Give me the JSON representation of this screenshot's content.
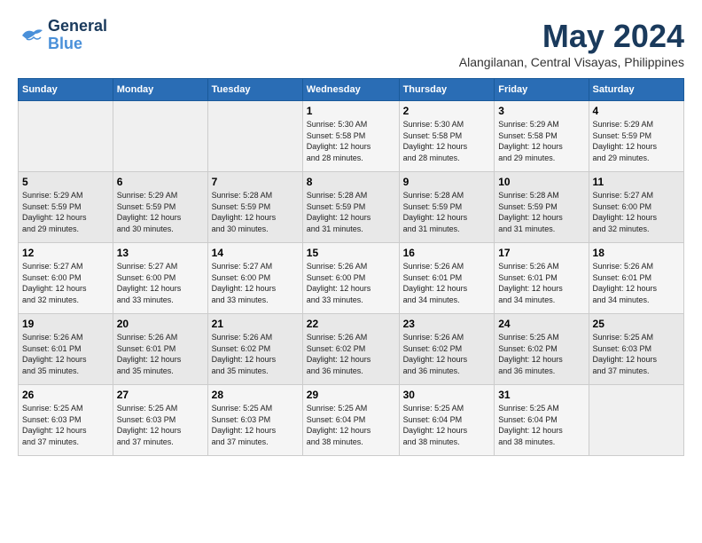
{
  "logo": {
    "line1": "General",
    "line2": "Blue"
  },
  "title": "May 2024",
  "subtitle": "Alangilanan, Central Visayas, Philippines",
  "days_of_week": [
    "Sunday",
    "Monday",
    "Tuesday",
    "Wednesday",
    "Thursday",
    "Friday",
    "Saturday"
  ],
  "weeks": [
    [
      {
        "day": "",
        "info": ""
      },
      {
        "day": "",
        "info": ""
      },
      {
        "day": "",
        "info": ""
      },
      {
        "day": "1",
        "info": "Sunrise: 5:30 AM\nSunset: 5:58 PM\nDaylight: 12 hours\nand 28 minutes."
      },
      {
        "day": "2",
        "info": "Sunrise: 5:30 AM\nSunset: 5:58 PM\nDaylight: 12 hours\nand 28 minutes."
      },
      {
        "day": "3",
        "info": "Sunrise: 5:29 AM\nSunset: 5:58 PM\nDaylight: 12 hours\nand 29 minutes."
      },
      {
        "day": "4",
        "info": "Sunrise: 5:29 AM\nSunset: 5:59 PM\nDaylight: 12 hours\nand 29 minutes."
      }
    ],
    [
      {
        "day": "5",
        "info": "Sunrise: 5:29 AM\nSunset: 5:59 PM\nDaylight: 12 hours\nand 29 minutes."
      },
      {
        "day": "6",
        "info": "Sunrise: 5:29 AM\nSunset: 5:59 PM\nDaylight: 12 hours\nand 30 minutes."
      },
      {
        "day": "7",
        "info": "Sunrise: 5:28 AM\nSunset: 5:59 PM\nDaylight: 12 hours\nand 30 minutes."
      },
      {
        "day": "8",
        "info": "Sunrise: 5:28 AM\nSunset: 5:59 PM\nDaylight: 12 hours\nand 31 minutes."
      },
      {
        "day": "9",
        "info": "Sunrise: 5:28 AM\nSunset: 5:59 PM\nDaylight: 12 hours\nand 31 minutes."
      },
      {
        "day": "10",
        "info": "Sunrise: 5:28 AM\nSunset: 5:59 PM\nDaylight: 12 hours\nand 31 minutes."
      },
      {
        "day": "11",
        "info": "Sunrise: 5:27 AM\nSunset: 6:00 PM\nDaylight: 12 hours\nand 32 minutes."
      }
    ],
    [
      {
        "day": "12",
        "info": "Sunrise: 5:27 AM\nSunset: 6:00 PM\nDaylight: 12 hours\nand 32 minutes."
      },
      {
        "day": "13",
        "info": "Sunrise: 5:27 AM\nSunset: 6:00 PM\nDaylight: 12 hours\nand 33 minutes."
      },
      {
        "day": "14",
        "info": "Sunrise: 5:27 AM\nSunset: 6:00 PM\nDaylight: 12 hours\nand 33 minutes."
      },
      {
        "day": "15",
        "info": "Sunrise: 5:26 AM\nSunset: 6:00 PM\nDaylight: 12 hours\nand 33 minutes."
      },
      {
        "day": "16",
        "info": "Sunrise: 5:26 AM\nSunset: 6:01 PM\nDaylight: 12 hours\nand 34 minutes."
      },
      {
        "day": "17",
        "info": "Sunrise: 5:26 AM\nSunset: 6:01 PM\nDaylight: 12 hours\nand 34 minutes."
      },
      {
        "day": "18",
        "info": "Sunrise: 5:26 AM\nSunset: 6:01 PM\nDaylight: 12 hours\nand 34 minutes."
      }
    ],
    [
      {
        "day": "19",
        "info": "Sunrise: 5:26 AM\nSunset: 6:01 PM\nDaylight: 12 hours\nand 35 minutes."
      },
      {
        "day": "20",
        "info": "Sunrise: 5:26 AM\nSunset: 6:01 PM\nDaylight: 12 hours\nand 35 minutes."
      },
      {
        "day": "21",
        "info": "Sunrise: 5:26 AM\nSunset: 6:02 PM\nDaylight: 12 hours\nand 35 minutes."
      },
      {
        "day": "22",
        "info": "Sunrise: 5:26 AM\nSunset: 6:02 PM\nDaylight: 12 hours\nand 36 minutes."
      },
      {
        "day": "23",
        "info": "Sunrise: 5:26 AM\nSunset: 6:02 PM\nDaylight: 12 hours\nand 36 minutes."
      },
      {
        "day": "24",
        "info": "Sunrise: 5:25 AM\nSunset: 6:02 PM\nDaylight: 12 hours\nand 36 minutes."
      },
      {
        "day": "25",
        "info": "Sunrise: 5:25 AM\nSunset: 6:03 PM\nDaylight: 12 hours\nand 37 minutes."
      }
    ],
    [
      {
        "day": "26",
        "info": "Sunrise: 5:25 AM\nSunset: 6:03 PM\nDaylight: 12 hours\nand 37 minutes."
      },
      {
        "day": "27",
        "info": "Sunrise: 5:25 AM\nSunset: 6:03 PM\nDaylight: 12 hours\nand 37 minutes."
      },
      {
        "day": "28",
        "info": "Sunrise: 5:25 AM\nSunset: 6:03 PM\nDaylight: 12 hours\nand 37 minutes."
      },
      {
        "day": "29",
        "info": "Sunrise: 5:25 AM\nSunset: 6:04 PM\nDaylight: 12 hours\nand 38 minutes."
      },
      {
        "day": "30",
        "info": "Sunrise: 5:25 AM\nSunset: 6:04 PM\nDaylight: 12 hours\nand 38 minutes."
      },
      {
        "day": "31",
        "info": "Sunrise: 5:25 AM\nSunset: 6:04 PM\nDaylight: 12 hours\nand 38 minutes."
      },
      {
        "day": "",
        "info": ""
      }
    ]
  ]
}
